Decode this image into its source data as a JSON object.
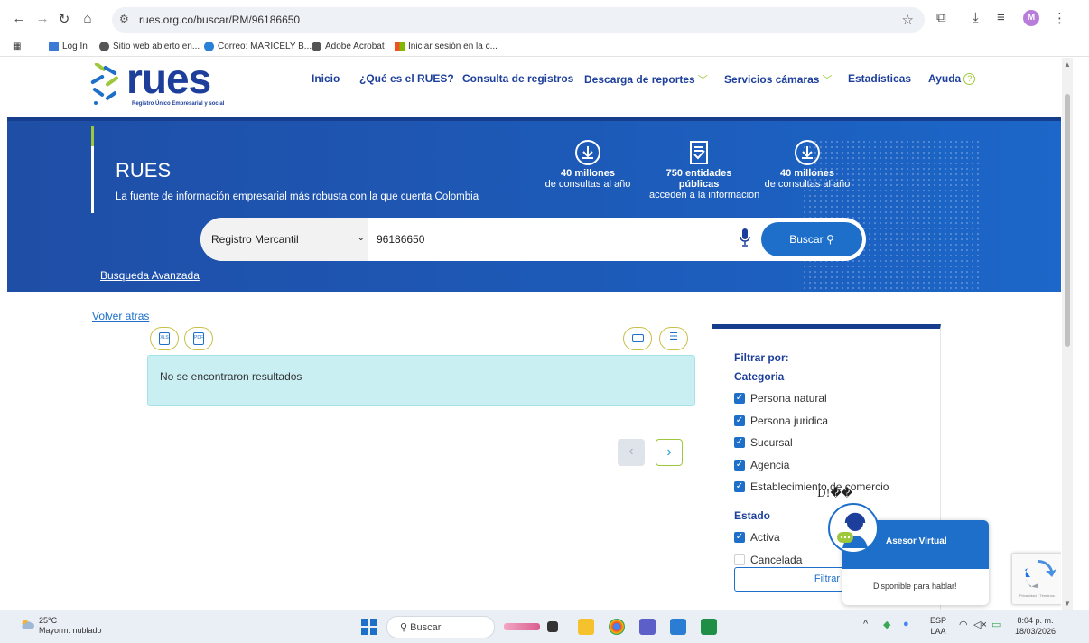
{
  "browser": {
    "url": "rues.org.co/buscar/RM/96186650",
    "profile_initial": "M",
    "bookmarks": [
      "Log In",
      "Sitio web abierto en...",
      "Correo: MARICELY B...",
      "Adobe Acrobat",
      "Iniciar sesión en la c..."
    ]
  },
  "header": {
    "logo_text": "rues",
    "logo_subtitle": "Registro Único Empresarial y social",
    "nav": [
      {
        "label": "Inicio"
      },
      {
        "label": "¿Qué es el RUES?"
      },
      {
        "label": "Consulta de registros"
      },
      {
        "label": "Descarga de reportes"
      },
      {
        "label": "Servicios cámaras"
      },
      {
        "label": "Estadísticas"
      },
      {
        "label": "Ayuda"
      }
    ]
  },
  "hero": {
    "title": "RUES",
    "subtitle": "La fuente de información empresarial más robusta con la que cuenta Colombia",
    "stats": [
      {
        "big": "40 millones",
        "small": "de consultas al año",
        "icon": "download-icon"
      },
      {
        "big": "750 entidades públicas",
        "small": "acceden a la informacion",
        "icon": "document-check-icon"
      },
      {
        "big": "40 millones",
        "small": "de consultas al año",
        "icon": "download-icon"
      }
    ]
  },
  "search": {
    "registry_selected": "Registro Mercantil",
    "query": "96186650",
    "button_label": "Buscar",
    "advanced_link": "Busqueda Avanzada"
  },
  "results": {
    "back_link": "Volver atras",
    "empty_message": "No se encontraron resultados",
    "export_icons": [
      "xls-export-icon",
      "pdf-export-icon"
    ],
    "view_icons": [
      "card-view-icon",
      "list-view-icon"
    ],
    "pager_prev": "‹",
    "pager_next": "›"
  },
  "filter": {
    "heading": "Filtrar por:",
    "category_heading": "Categoria",
    "categories": [
      {
        "label": "Persona natural",
        "checked": true
      },
      {
        "label": "Persona juridica",
        "checked": true
      },
      {
        "label": "Sucursal",
        "checked": true
      },
      {
        "label": "Agencia",
        "checked": true
      },
      {
        "label": "Establecimiento de comercio",
        "checked": true
      }
    ],
    "status_heading": "Estado",
    "statuses": [
      {
        "label": "Activa",
        "checked": true
      },
      {
        "label": "Cancelada",
        "checked": false
      }
    ],
    "button_label": "Filtrar"
  },
  "garbled_text": "D!��",
  "chat": {
    "name": "Asesor Virtual",
    "status": "Disponible para hablar!"
  },
  "recaptcha": {
    "label": "Privacidad - Términos"
  },
  "taskbar": {
    "temperature": "25°C",
    "weather": "Mayorm. nublado",
    "search_label": "Buscar",
    "lang_top": "ESP",
    "lang_bottom": "LAA",
    "time": "8:04 p. m.",
    "date": "18/03/2026"
  },
  "colors": {
    "brand": "#1d3f9b",
    "accent": "#9dc83b",
    "button": "#1d6fc9",
    "result_bg": "#c9eff3"
  }
}
